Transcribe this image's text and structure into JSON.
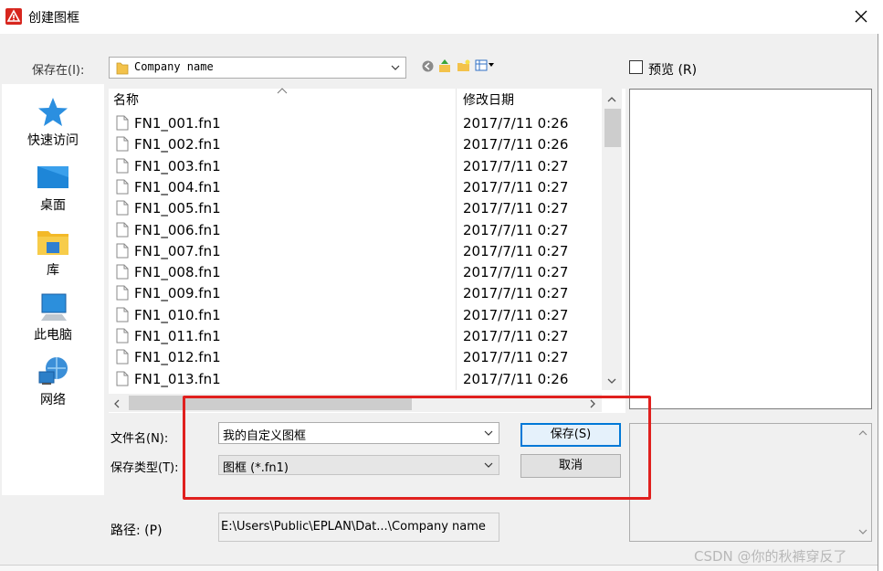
{
  "window": {
    "title": "创建图框",
    "close_icon": "close-icon"
  },
  "save_in": {
    "label": "保存在(I):",
    "value": "Company name"
  },
  "preview": {
    "label": "预览 (R)",
    "checked": false
  },
  "places": [
    {
      "label": "快速访问",
      "icon": "star-icon"
    },
    {
      "label": "桌面",
      "icon": "desktop-icon"
    },
    {
      "label": "库",
      "icon": "library-folder-icon"
    },
    {
      "label": "此电脑",
      "icon": "computer-icon"
    },
    {
      "label": "网络",
      "icon": "network-icon"
    }
  ],
  "file_list": {
    "columns": [
      "名称",
      "修改日期"
    ],
    "rows": [
      {
        "name": "FN1_001.fn1",
        "date": "2017/7/11 0:26"
      },
      {
        "name": "FN1_002.fn1",
        "date": "2017/7/11 0:26"
      },
      {
        "name": "FN1_003.fn1",
        "date": "2017/7/11 0:27"
      },
      {
        "name": "FN1_004.fn1",
        "date": "2017/7/11 0:27"
      },
      {
        "name": "FN1_005.fn1",
        "date": "2017/7/11 0:27"
      },
      {
        "name": "FN1_006.fn1",
        "date": "2017/7/11 0:27"
      },
      {
        "name": "FN1_007.fn1",
        "date": "2017/7/11 0:27"
      },
      {
        "name": "FN1_008.fn1",
        "date": "2017/7/11 0:27"
      },
      {
        "name": "FN1_009.fn1",
        "date": "2017/7/11 0:27"
      },
      {
        "name": "FN1_010.fn1",
        "date": "2017/7/11 0:27"
      },
      {
        "name": "FN1_011.fn1",
        "date": "2017/7/11 0:27"
      },
      {
        "name": "FN1_012.fn1",
        "date": "2017/7/11 0:27"
      },
      {
        "name": "FN1_013.fn1",
        "date": "2017/7/11 0:26"
      }
    ]
  },
  "filename": {
    "label": "文件名(N):",
    "value": "我的自定义图框"
  },
  "filetype": {
    "label": "保存类型(T):",
    "value": "图框 (*.fn1)"
  },
  "buttons": {
    "save": "保存(S)",
    "cancel": "取消"
  },
  "path": {
    "label": "路径: (P)",
    "value": "E:\\Users\\Public\\EPLAN\\Dat...\\Company name"
  },
  "watermark": "CSDN @你的秋裤穿反了",
  "colors": {
    "highlight": "#e0201e",
    "accent": "#0078d7",
    "app_icon": "#d7261e"
  }
}
